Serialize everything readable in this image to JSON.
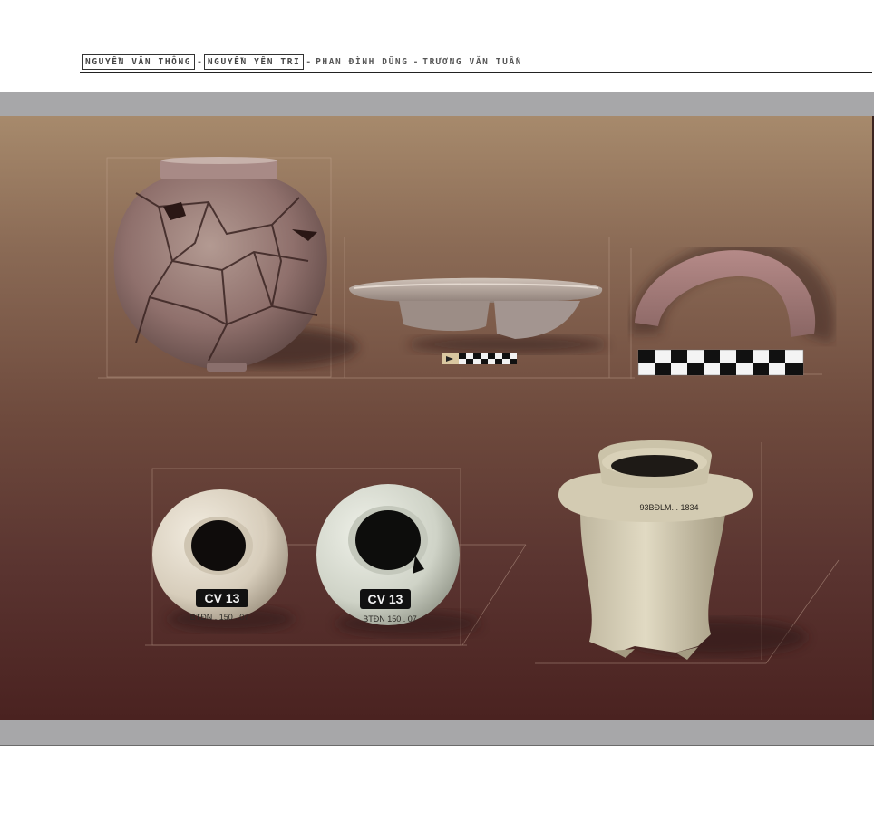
{
  "header": {
    "authors": [
      {
        "name": "NGUYỄN VĂN THÔNG",
        "boxed": true
      },
      {
        "name": "NGUYỄN YÊN TRI",
        "boxed": true
      },
      {
        "name": "PHAN ĐÌNH DŨNG",
        "boxed": false
      },
      {
        "name": "TRƯƠNG VĂN TUẤN",
        "boxed": false
      }
    ],
    "separator": "-"
  },
  "artifacts": {
    "jar_large": {
      "name": "cracked-jar"
    },
    "bowl_rim": {
      "name": "bowl-rim-fragment"
    },
    "arc_handle": {
      "name": "arc-handle-fragment"
    },
    "small_jar_left": {
      "label": "CV 13",
      "sub": "BTĐN . 150 . 07"
    },
    "small_jar_right": {
      "label": "CV 13",
      "sub": "BTĐN 150 . 07"
    },
    "pot_stand": {
      "inscription": "93BĐLM. . 1834"
    }
  },
  "colors": {
    "panel_top": "#a78a6c",
    "panel_bottom": "#4a2220",
    "bar": "#a7a7a9",
    "header_text": "#555555"
  }
}
